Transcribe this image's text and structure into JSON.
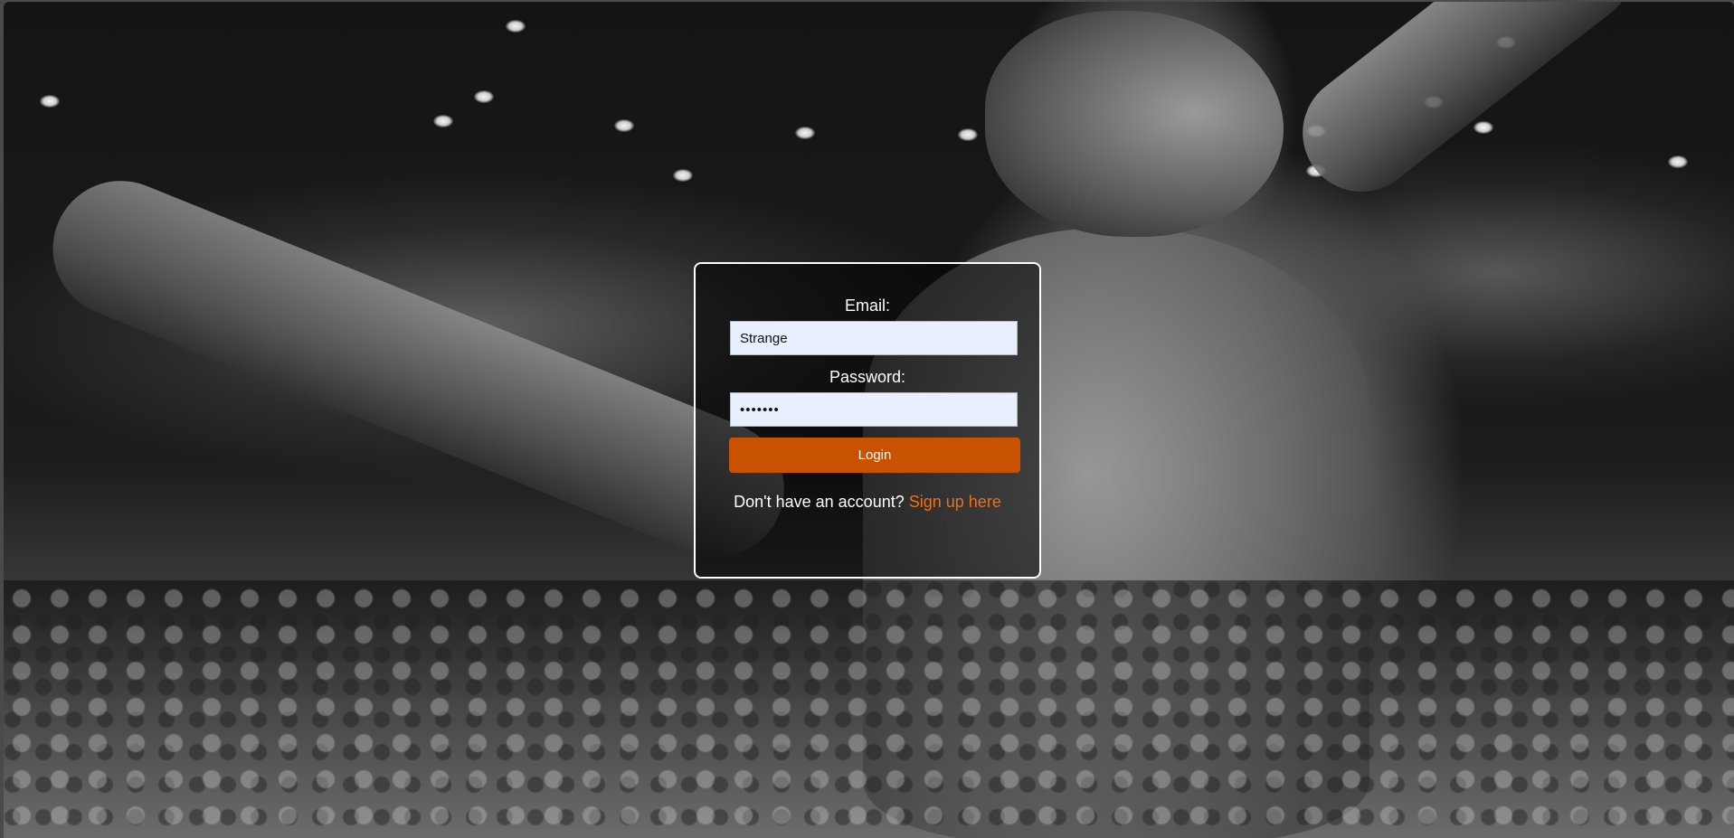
{
  "login_form": {
    "email_label": "Email:",
    "email_value": "Strange",
    "password_label": "Password:",
    "password_value": "•••••••",
    "login_button": "Login",
    "signup_prompt": "Don't have an account?",
    "signup_link": "Sign up here"
  },
  "colors": {
    "accent": "#c85200",
    "link": "#e8711e",
    "input_background": "#e8f0fe",
    "card_border": "#ffffff"
  },
  "background": {
    "style": "grayscale"
  }
}
